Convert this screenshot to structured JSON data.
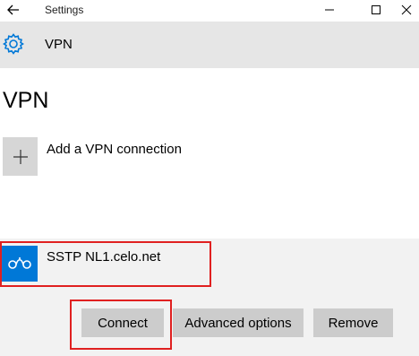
{
  "titlebar": {
    "app_title": "Settings",
    "back_icon": "back-arrow-icon",
    "minimize_icon": "minimize-icon",
    "maximize_icon": "maximize-icon",
    "close_icon": "close-icon"
  },
  "header": {
    "icon": "gear-icon",
    "title": "VPN"
  },
  "page": {
    "heading": "VPN"
  },
  "add_vpn": {
    "icon": "plus-icon",
    "label": "Add a VPN connection"
  },
  "connection": {
    "icon": "vpn-network-icon",
    "name": "SSTP NL1.celo.net",
    "buttons": {
      "connect": "Connect",
      "advanced": "Advanced options",
      "remove": "Remove"
    }
  },
  "colors": {
    "accent": "#0078d7",
    "highlight": "#e02020",
    "header_band": "#e6e6e6",
    "panel": "#f2f2f2",
    "button": "#cccccc"
  }
}
